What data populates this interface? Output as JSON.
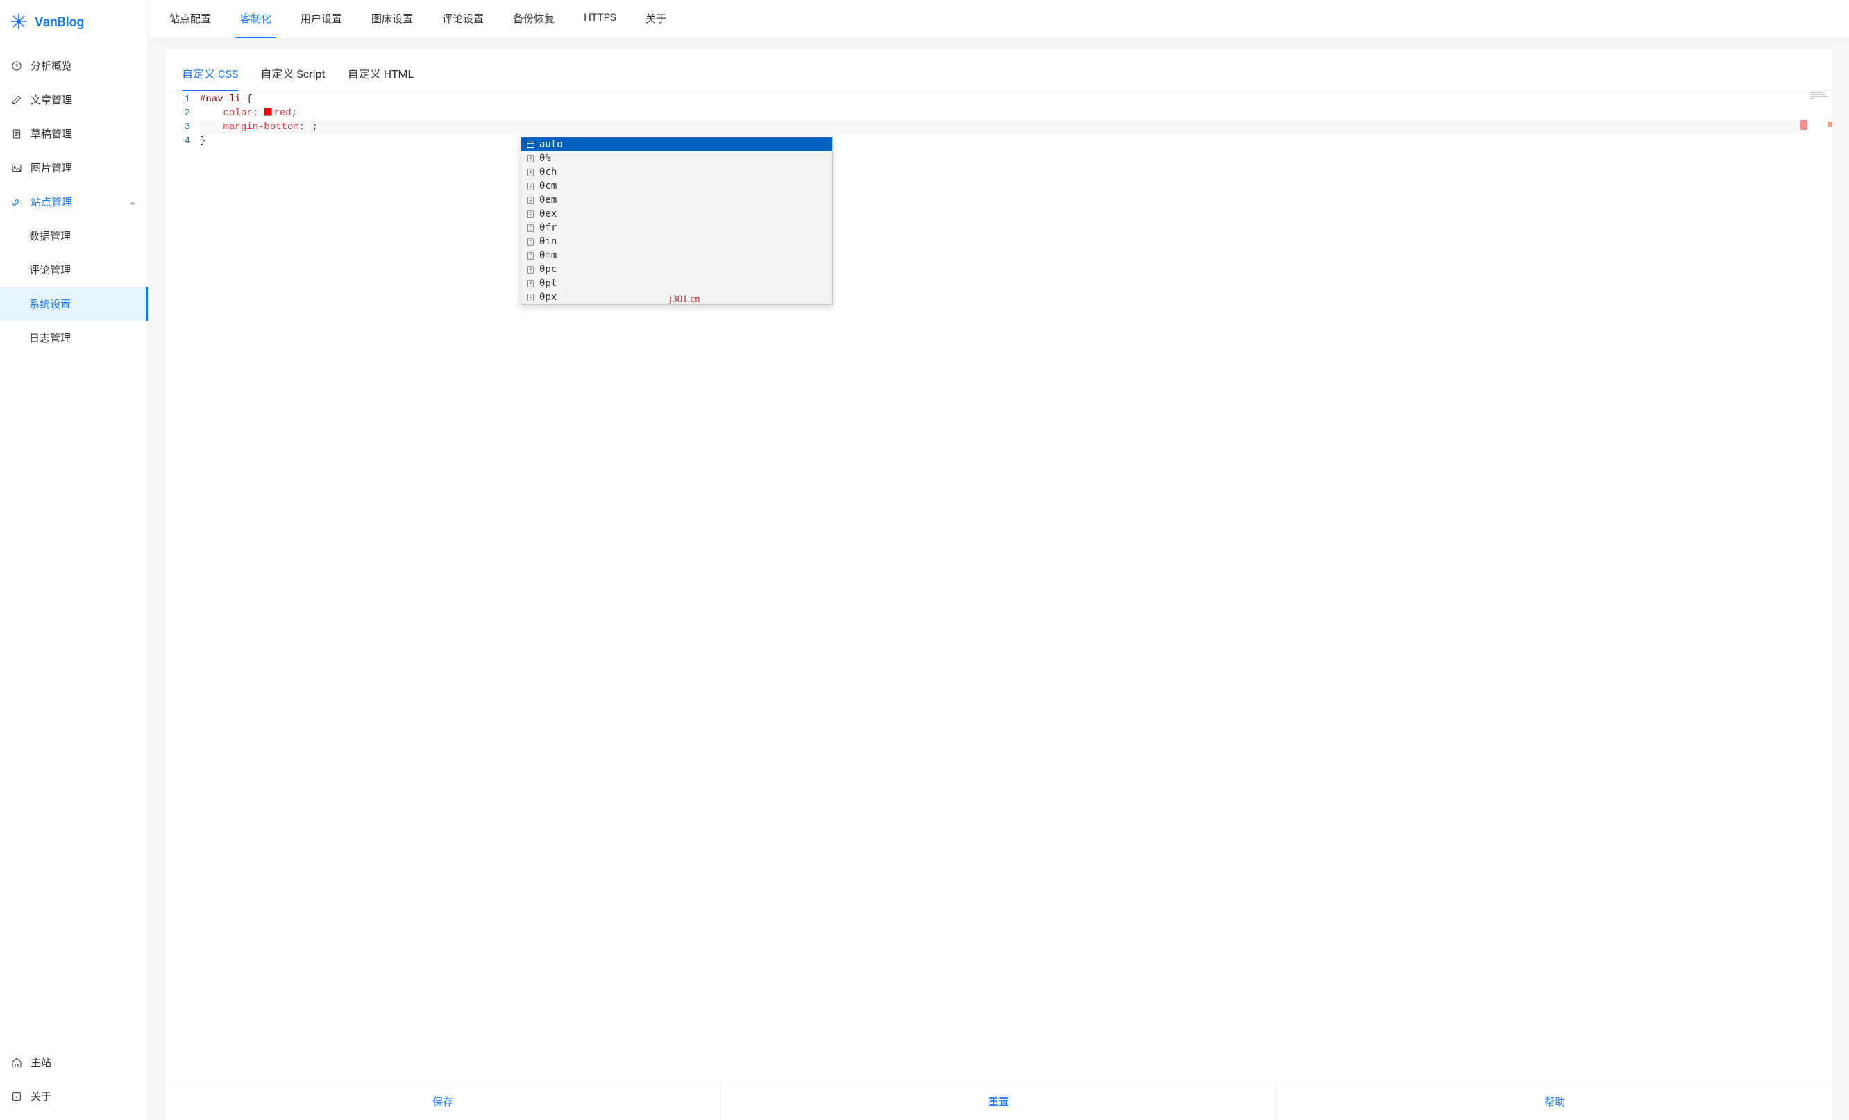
{
  "brand": {
    "name": "VanBlog"
  },
  "sidebar": {
    "items": [
      {
        "label": "分析概览",
        "icon": "clock-icon"
      },
      {
        "label": "文章管理",
        "icon": "edit-icon"
      },
      {
        "label": "草稿管理",
        "icon": "file-icon"
      },
      {
        "label": "图片管理",
        "icon": "image-icon"
      }
    ],
    "group": {
      "label": "站点管理",
      "icon": "wrench-icon",
      "expanded": true
    },
    "children": [
      {
        "label": "数据管理"
      },
      {
        "label": "评论管理"
      },
      {
        "label": "系统设置",
        "active": true
      },
      {
        "label": "日志管理"
      }
    ],
    "bottom": [
      {
        "label": "主站",
        "icon": "home-icon"
      },
      {
        "label": "关于",
        "icon": "info-icon"
      }
    ]
  },
  "topTabs": [
    {
      "label": "站点配置"
    },
    {
      "label": "客制化",
      "active": true
    },
    {
      "label": "用户设置"
    },
    {
      "label": "图床设置"
    },
    {
      "label": "评论设置"
    },
    {
      "label": "备份恢复"
    },
    {
      "label": "HTTPS"
    },
    {
      "label": "关于"
    }
  ],
  "subTabs": [
    {
      "label": "自定义 CSS",
      "active": true
    },
    {
      "label": "自定义 Script"
    },
    {
      "label": "自定义 HTML"
    }
  ],
  "editor": {
    "lines": [
      "1",
      "2",
      "3",
      "4"
    ],
    "code": {
      "l1_selector": "#nav li ",
      "l1_brace": "{",
      "l2_indent": "    ",
      "l2_prop": "color",
      "l2_colon": ": ",
      "l2_val": "red",
      "l2_semi": ";",
      "l3_indent": "    ",
      "l3_prop": "margin-bottom",
      "l3_colon": ": ",
      "l3_semi": ";",
      "l4_brace": "}"
    }
  },
  "autocomplete": {
    "items": [
      {
        "label": "auto",
        "selected": true,
        "kind": "keyword"
      },
      {
        "label": "0%",
        "kind": "value"
      },
      {
        "label": "0ch",
        "kind": "value"
      },
      {
        "label": "0cm",
        "kind": "value"
      },
      {
        "label": "0em",
        "kind": "value"
      },
      {
        "label": "0ex",
        "kind": "value"
      },
      {
        "label": "0fr",
        "kind": "value"
      },
      {
        "label": "0in",
        "kind": "value"
      },
      {
        "label": "0mm",
        "kind": "value"
      },
      {
        "label": "0pc",
        "kind": "value"
      },
      {
        "label": "0pt",
        "kind": "value"
      },
      {
        "label": "0px",
        "kind": "value"
      }
    ]
  },
  "watermark": "j301.cn",
  "footer": {
    "save": "保存",
    "reset": "重置",
    "help": "帮助"
  }
}
